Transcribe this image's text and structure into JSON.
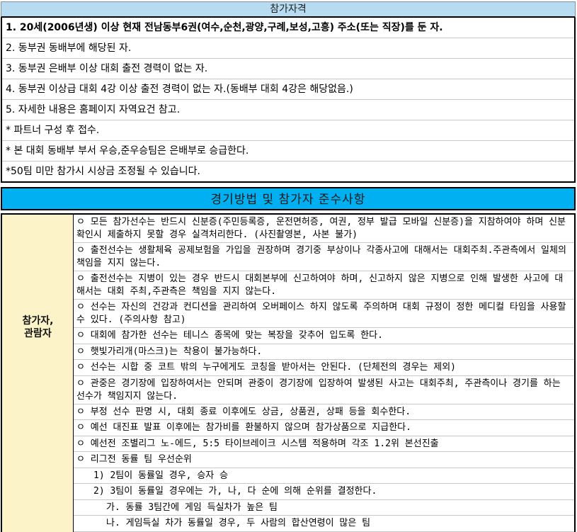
{
  "eligibility": {
    "title": "참가자격",
    "items": [
      "1. 20세(2006년생) 이상 현재 전남동부6권(여수,순천,광양,구례,보성,고흥) 주소(또는 직장)를 둔 자.",
      "2. 동부권 동배부에 해당된 자.",
      "3. 동부권 은배부 이상 대회 출전 경력이 없는 자.",
      "4. 동부권 이상급 대회 4강 이상 출전 경력이 없는 자.(동배부 대회 4강은 해당없음.)",
      "5. 자세한 내용은 홈페이지 자역요건 참고.",
      "* 파트너 구성 후 접수.",
      "* 본 대회 동배부 부서 우승,준우승팀은 은배부로 승급한다.",
      "*50팀 미만 참가시 시상금 조정될 수 있습니다."
    ]
  },
  "rules": {
    "title": "경기방법 및 참가자 준수사항",
    "left_label_line1": "참가자,",
    "left_label_line2": "관람자",
    "items": [
      "ㅇ 모든 참가선수는 반드시 신분증(주민등록증, 운전면허증, 여권, 정부 발급 모바일 신분증)을 지참하여야 하며 신분확인시 제출하지 못할 경우 실격처리한다. (사진촬영본, 사본 불가)",
      "ㅇ 출전선수는 생활체육 공제보험을 가입을 권장하며 경기중 부상이나 각종사고에 대해서는 대회주최.주관측에서 일체의 책임을 지지 않는다.",
      "ㅇ 출전선수는 지병이 있는 경우 반드시 대회본부에 신고하여야 하며, 신고하지 않은 지병으로 인해 발생한 사고에 대해서는 대회 주최,주관측은 책임을 지지 않는다.",
      "ㅇ 선수는 자신의 건강과 컨디션을 관리하여 오버페이스 하지 않도록 주의하며 대회 규정이 정한 메디컬 타임을 사용할 수 있다. (주의사항 참고)",
      "ㅇ 대회에 참가한 선수는 테니스 종목에 맞는 복장을 갖추어 입도록 한다.",
      "ㅇ 햇빛가리개(마스크)는 착용이 불가능하다.",
      "ㅇ 선수는 시합 중 코트 밖의 누구에게도 코칭을 받아서는 안된다. (단체전의 경우는 제외)",
      "ㅇ 관중은 경기장에 입장하여서는 안되며 관중이 경기장에 입장하여 발생된 사고는 대회주최, 주관측이나 경기를 하는 선수가 책임지지 않는다.",
      "ㅇ 부정 선수 판명 시, 대회 종료 이후에도 상금, 상품권, 상패 등을 회수한다.",
      "ㅇ 예선 대진표 발표 이후에는 참가비를 환불하지 않으며 참가상품으로 지급한다.",
      "ㅇ 예선전 조별리그 노-에드, 5:5 타이브레이크 시스템 적용하며 각조 1.2위 본선진출",
      "ㅇ 리그전 동률 팀 우선순위",
      "1) 2팀이 동률일 경우, 승자 승",
      "2) 3팀이 동률일 경우에는 가, 나, 다 순에 의해 순위를 결정한다.",
      "가. 동률 3팀간에 게임 득실차가 높은 팀",
      "나. 게임득실 차가 동률일 경우, 두 사람의 합산연령이 많은 팀"
    ]
  }
}
